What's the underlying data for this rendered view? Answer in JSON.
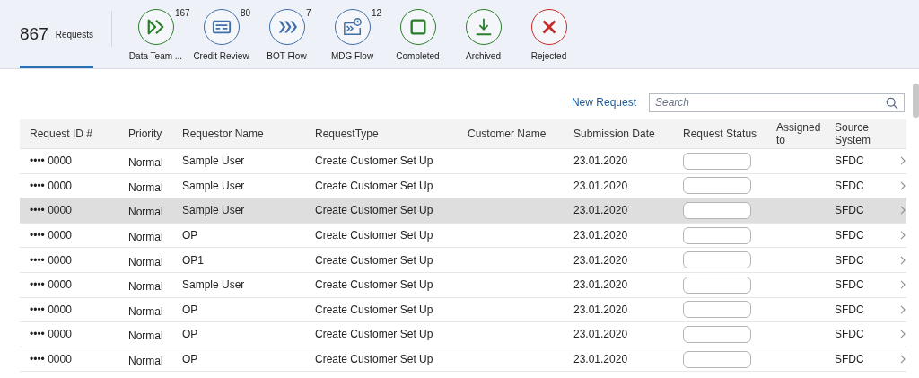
{
  "summary_tab": {
    "count": "867",
    "label": "Requests",
    "selected": true
  },
  "status_tabs": [
    {
      "label": "Data Team ...",
      "count": "167",
      "kind": "forward",
      "color": "#2b7d2b",
      "selected": false
    },
    {
      "label": "Credit Review",
      "count": "80",
      "kind": "card",
      "color": "#3f6fa8",
      "selected": false
    },
    {
      "label": "BOT Flow",
      "count": "7",
      "kind": "chevrons",
      "color": "#3f6fa8",
      "selected": false
    },
    {
      "label": "MDG Flow",
      "count": "12",
      "kind": "doc",
      "color": "#3f6fa8",
      "selected": false
    },
    {
      "label": "Completed",
      "kind": "square",
      "color": "#2b7d2b",
      "selected": false
    },
    {
      "label": "Archived",
      "kind": "download",
      "color": "#2b7d2b",
      "selected": false
    },
    {
      "label": "Rejected",
      "kind": "cross",
      "color": "#c42b2b",
      "selected": false
    }
  ],
  "new_request": "New Request",
  "search": {
    "placeholder": "Search"
  },
  "table": {
    "columns": [
      "Request ID #",
      "Priority",
      "Requestor Name",
      "RequestType",
      "Customer Name",
      "Submission Date",
      "Request Status",
      "Assigned to",
      "Source System"
    ],
    "rows": [
      {
        "id": "•••• 0000",
        "priority": "Normal",
        "requestor": "Sample User",
        "type": "Create Customer Set Up",
        "date": "23.01.2020",
        "source": "SFDC",
        "selected": false
      },
      {
        "id": "•••• 0000",
        "priority": "Normal",
        "requestor": "Sample User",
        "type": "Create Customer Set Up",
        "date": "23.01.2020",
        "source": "SFDC",
        "selected": false
      },
      {
        "id": "•••• 0000",
        "priority": "Normal",
        "requestor": "Sample User",
        "type": "Create Customer Set Up",
        "date": "23.01.2020",
        "source": "SFDC",
        "selected": true
      },
      {
        "id": "•••• 0000",
        "priority": "Normal",
        "requestor": "OP",
        "type": "Create Customer Set Up",
        "date": "23.01.2020",
        "source": "SFDC",
        "selected": false
      },
      {
        "id": "•••• 0000",
        "priority": "Normal",
        "requestor": "OP1",
        "type": "Create Customer Set Up",
        "date": "23.01.2020",
        "source": "SFDC",
        "selected": false
      },
      {
        "id": "•••• 0000",
        "priority": "Normal",
        "requestor": "Sample User",
        "type": "Create Customer Set Up",
        "date": "23.01.2020",
        "source": "SFDC",
        "selected": false
      },
      {
        "id": "•••• 0000",
        "priority": "Normal",
        "requestor": "OP",
        "type": "Create Customer Set Up",
        "date": "23.01.2020",
        "source": "SFDC",
        "selected": false
      },
      {
        "id": "•••• 0000",
        "priority": "Normal",
        "requestor": "OP",
        "type": "Create Customer Set Up",
        "date": "23.01.2020",
        "source": "SFDC",
        "selected": false
      },
      {
        "id": "•••• 0000",
        "priority": "Normal",
        "requestor": "OP",
        "type": "Create Customer Set Up",
        "date": "23.01.2020",
        "source": "SFDC",
        "selected": false
      }
    ]
  }
}
